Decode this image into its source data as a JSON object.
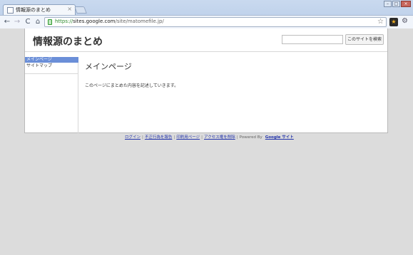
{
  "browser": {
    "tab": {
      "title": "情報源のまとめ",
      "close": "×"
    },
    "window_controls": {
      "minimize": "–",
      "maximize": "□",
      "close": "×"
    },
    "nav": {
      "back": "←",
      "forward": "→",
      "reload": "C",
      "home": "⌂"
    },
    "omnibox": {
      "scheme": "https://",
      "host": "sites.google.com",
      "path": "/site/matomefile.jp/"
    },
    "star": "☆",
    "wrench": "🔧",
    "ext": "★"
  },
  "site": {
    "title": "情報源のまとめ",
    "search_button": "このサイトを検索",
    "search_value": ""
  },
  "sidebar": {
    "items": [
      {
        "label": "メインページ",
        "active": true
      },
      {
        "label": "サイトマップ",
        "active": false
      }
    ]
  },
  "main": {
    "title": "メインページ",
    "text": "このページにまとめた内容を記述していきます。"
  },
  "footer": {
    "links": [
      "ログイン",
      "不正行為を報告",
      "印刷用ページ",
      "アクセス権を削除"
    ],
    "powered_by": "Powered By",
    "google_sites": "Google サイト"
  }
}
